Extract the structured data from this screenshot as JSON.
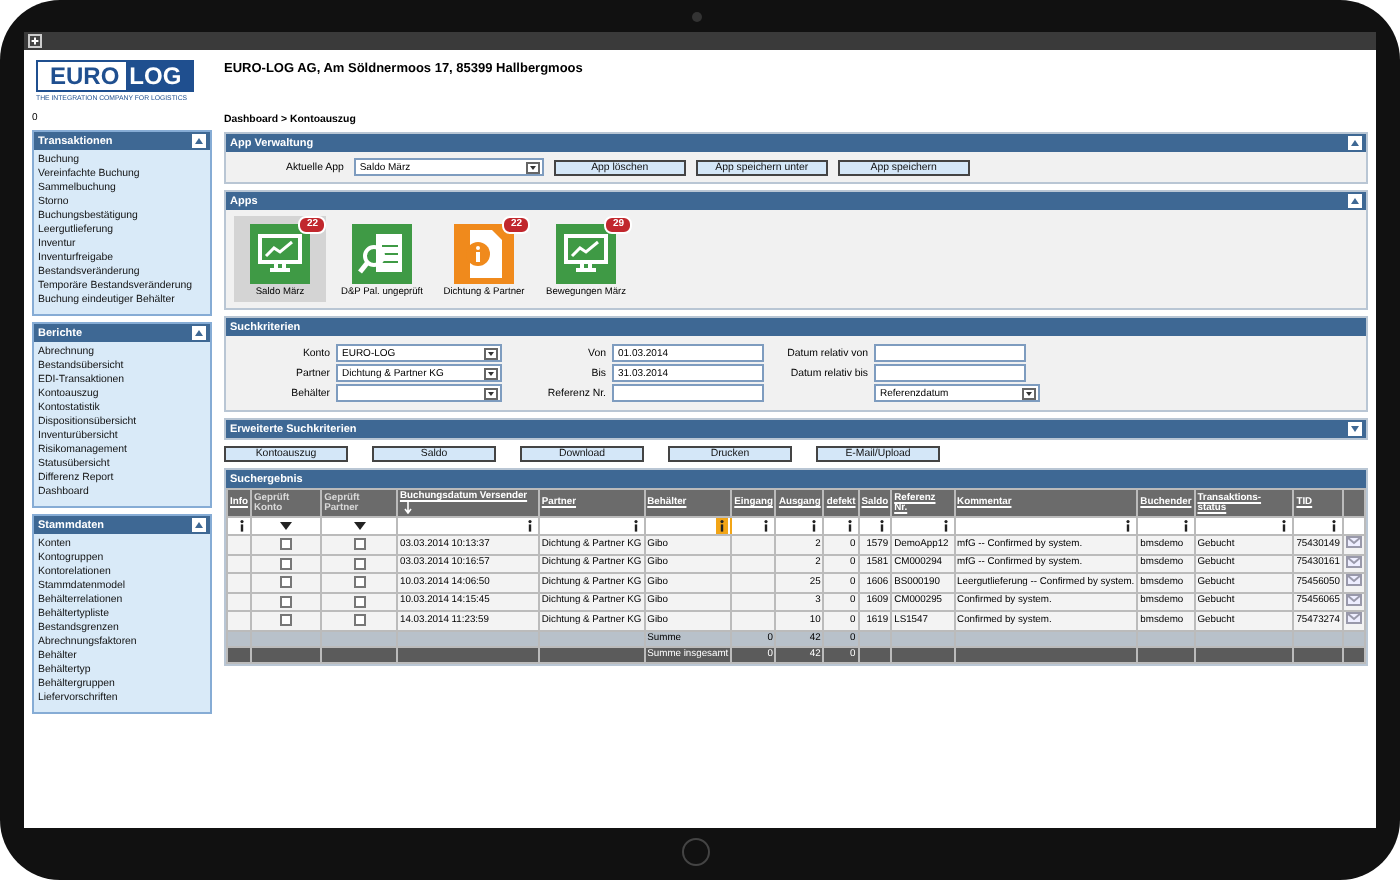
{
  "logo": {
    "part_1": "EURO",
    "part_2": "LOG",
    "tagline": "THE INTEGRATION COMPANY FOR LOGISTICS"
  },
  "company": "EURO-LOG AG, Am Söldnermoos 17, 85399 Hallbergmoos",
  "sidebar": {
    "counter": "0",
    "sections": [
      {
        "title": "Transaktionen",
        "expanded": true,
        "items": [
          "Buchung",
          "Vereinfachte Buchung",
          "Sammelbuchung",
          "Storno",
          "Buchungsbestätigung",
          "Leergutlieferung",
          "Inventur",
          "Inventurfreigabe",
          "Bestandsveränderung",
          "Temporäre Bestandsveränderung",
          "Buchung eindeutiger Behälter"
        ]
      },
      {
        "title": "Berichte",
        "expanded": true,
        "items": [
          "Abrechnung",
          "Bestandsübersicht",
          "EDI-Transaktionen",
          "Kontoauszug",
          "Kontostatistik",
          "Dispositionsübersicht",
          "Inventurübersicht",
          "Risikomanagement",
          "Statusübersicht",
          "Differenz Report",
          "Dashboard"
        ]
      },
      {
        "title": "Stammdaten",
        "expanded": true,
        "items": [
          "Konten",
          "Kontogruppen",
          "Kontorelationen",
          "Stammdatenmodel",
          "Behälterrelationen",
          "Behältertypliste",
          "Bestandsgrenzen",
          "Abrechnungsfaktoren",
          "Behälter",
          "Behältertyp",
          "Behältergruppen",
          "Liefervorschriften"
        ]
      }
    ]
  },
  "breadcrumb": "Dashboard > Kontoauszug",
  "app_management": {
    "title": "App Verwaltung",
    "expanded": true,
    "current_app_label": "Aktuelle App",
    "current_app": "Saldo März",
    "buttons": [
      "App löschen",
      "App speichern unter",
      "App speichern"
    ]
  },
  "apps": {
    "title": "Apps",
    "expanded": true,
    "tiles": [
      {
        "label": "Saldo März",
        "badge": "22",
        "kind": "monitor",
        "color": "#3f9a45",
        "selected": true
      },
      {
        "label": "D&P Pal. ungeprüft",
        "kind": "sheet-search",
        "color": "#3f9a45",
        "selected": false
      },
      {
        "label": "Dichtung & Partner",
        "badge": "22",
        "kind": "info-document",
        "color": "#f08a1c",
        "selected": false
      },
      {
        "label": "Bewegungen März",
        "badge": "29",
        "kind": "monitor",
        "color": "#3f9a45",
        "selected": false
      }
    ]
  },
  "search_criteria": {
    "title": "Suchkriterien",
    "columns": [
      [
        {
          "label": "Konto",
          "kind": "select",
          "value": "EURO-LOG"
        },
        {
          "label": "Partner",
          "kind": "select",
          "value": "Dichtung & Partner KG"
        },
        {
          "label": "Behälter",
          "kind": "select"
        }
      ],
      [
        {
          "label": "Von",
          "kind": "input",
          "value": "01.03.2014"
        },
        {
          "label": "Bis",
          "kind": "input",
          "value": "31.03.2014"
        },
        {
          "label": "Referenz Nr.",
          "kind": "input"
        }
      ],
      [
        {
          "label": "Datum relativ von",
          "kind": "input"
        },
        {
          "label": "Datum relativ bis",
          "kind": "input"
        },
        {
          "kind": "select",
          "value": "Referenzdatum"
        }
      ]
    ]
  },
  "extended_search": {
    "title": "Erweiterte Suchkriterien",
    "expanded": false
  },
  "action_buttons": [
    "Kontoauszug",
    "Saldo",
    "Download",
    "Drucken",
    "E-Mail/Upload"
  ],
  "results": {
    "title": "Suchergebnis",
    "columns": [
      {
        "label": "Info",
        "link": true,
        "filter": {
          "kind": "text",
          "active": false
        }
      },
      {
        "label": "Geprüft Konto",
        "link": false,
        "filter": {
          "kind": "dropdown"
        }
      },
      {
        "label": "Geprüft Partner",
        "link": false,
        "filter": {
          "kind": "dropdown"
        }
      },
      {
        "label": "Buchungsdatum Versender",
        "link": true,
        "sorted_descending": true,
        "filter": {
          "kind": "text",
          "active": false
        }
      },
      {
        "label": "Partner",
        "link": true,
        "filter": {
          "kind": "text",
          "active": false
        }
      },
      {
        "label": "Behälter",
        "link": true,
        "filter": {
          "kind": "text",
          "active": true
        }
      },
      {
        "label": "Eingang",
        "link": true,
        "filter": {
          "kind": "text",
          "active": false
        }
      },
      {
        "label": "Ausgang",
        "link": true,
        "filter": {
          "kind": "text",
          "active": false
        }
      },
      {
        "label": "defekt",
        "link": true,
        "filter": {
          "kind": "text",
          "active": false
        }
      },
      {
        "label": "Saldo",
        "link": true,
        "filter": {
          "kind": "text",
          "active": false
        }
      },
      {
        "label": "Referenz Nr.",
        "link": true,
        "filter": {
          "kind": "text",
          "active": false
        }
      },
      {
        "label": "Kommentar",
        "link": true,
        "filter": {
          "kind": "text",
          "active": false
        }
      },
      {
        "label": "Buchender",
        "link": true,
        "filter": {
          "kind": "text",
          "active": false
        }
      },
      {
        "label": "Transaktions- status",
        "link": true,
        "filter": {
          "kind": "text",
          "active": false
        }
      },
      {
        "label": "TID",
        "link": true,
        "filter": {
          "kind": "text",
          "active": false
        }
      }
    ],
    "rows": [
      {
        "checked_konto": false,
        "checked_partner": false,
        "date": "03.03.2014 10:13:37",
        "partner": "Dichtung & Partner KG",
        "container": "Gibo",
        "outgoing": "2",
        "defect": "0",
        "balance": "1579",
        "reference": "DemoApp12",
        "comment": "mfG -- Confirmed by system.",
        "booker": "bmsdemo",
        "status": "Gebucht",
        "tid": "75430149"
      },
      {
        "checked_konto": false,
        "checked_partner": false,
        "date": "03.03.2014 10:16:57",
        "partner": "Dichtung & Partner KG",
        "container": "Gibo",
        "outgoing": "2",
        "defect": "0",
        "balance": "1581",
        "reference": "CM000294",
        "comment": "mfG -- Confirmed by system.",
        "booker": "bmsdemo",
        "status": "Gebucht",
        "tid": "75430161"
      },
      {
        "checked_konto": false,
        "checked_partner": false,
        "date": "10.03.2014 14:06:50",
        "partner": "Dichtung & Partner KG",
        "container": "Gibo",
        "outgoing": "25",
        "defect": "0",
        "balance": "1606",
        "reference": "BS000190",
        "comment": "Leergutlieferung -- Confirmed by system.",
        "booker": "bmsdemo",
        "status": "Gebucht",
        "tid": "75456050"
      },
      {
        "checked_konto": false,
        "checked_partner": false,
        "date": "10.03.2014 14:15:45",
        "partner": "Dichtung & Partner KG",
        "container": "Gibo",
        "outgoing": "3",
        "defect": "0",
        "balance": "1609",
        "reference": "CM000295",
        "comment": "Confirmed by system.",
        "booker": "bmsdemo",
        "status": "Gebucht",
        "tid": "75456065"
      },
      {
        "checked_konto": false,
        "checked_partner": false,
        "date": "14.03.2014 11:23:59",
        "partner": "Dichtung & Partner KG",
        "container": "Gibo",
        "outgoing": "10",
        "defect": "0",
        "balance": "1619",
        "reference": "LS1547",
        "comment": "Confirmed by system.",
        "booker": "bmsdemo",
        "status": "Gebucht",
        "tid": "75473274"
      }
    ],
    "totals": [
      {
        "kind": "page",
        "label": "Summe",
        "incoming": "0",
        "outgoing": "42",
        "defect": "0"
      },
      {
        "kind": "grand",
        "label": "Summe insgesamt",
        "incoming": "0",
        "outgoing": "42",
        "defect": "0"
      }
    ]
  }
}
